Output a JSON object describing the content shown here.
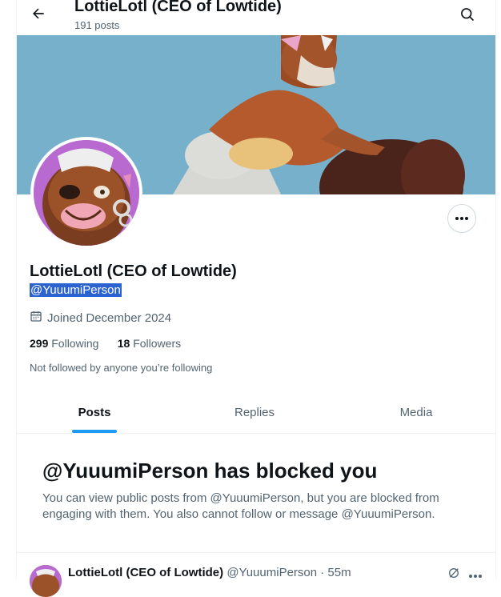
{
  "header": {
    "title": "LottieLotl (CEO of Lowtide)",
    "posts_count": "191 posts"
  },
  "profile": {
    "name": "LottieLotl (CEO of Lowtide)",
    "handle": "@YuuumiPerson",
    "joined": "Joined December 2024",
    "following_count": "299",
    "following_label": "Following",
    "followers_count": "18",
    "followers_label": "Followers",
    "not_followed_note": "Not followed by anyone you’re following"
  },
  "tabs": [
    {
      "label": "Posts",
      "active": true
    },
    {
      "label": "Replies",
      "active": false
    },
    {
      "label": "Media",
      "active": false
    }
  ],
  "blocked": {
    "title": "@YuuumiPerson has blocked you",
    "message": "You can view public posts from @YuuumiPerson, but you are blocked from engaging with them. You also cannot follow or message @YuuumiPerson."
  },
  "post": {
    "author": "LottieLotl (CEO of Lowtide)",
    "meta": "@YuuumiPerson · 55m"
  },
  "colors": {
    "accent": "#1d9bf0",
    "banner": "#76b0cb",
    "avatar_bg": "#b86ad0",
    "selection": "#2b63d1"
  },
  "icons": [
    "back-arrow-icon",
    "search-icon",
    "more-icon",
    "calendar-icon",
    "grok-icon",
    "post-more-icon"
  ]
}
